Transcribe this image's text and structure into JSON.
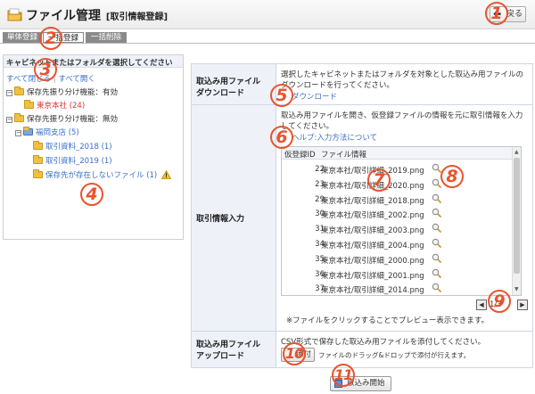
{
  "header": {
    "title": "ファイル管理",
    "subtitle": "[取引情報登録]",
    "back_label": "戻る"
  },
  "tabs": [
    "単体登録",
    "一括登録",
    "一括削除"
  ],
  "tree": {
    "heading": "キャビネットまたはフォルダを選択してください",
    "close_all": "すべて閉じる",
    "open_all": "すべて開く",
    "items": [
      {
        "label": "保存先振り分け機能：有効",
        "level": 0,
        "type": "toggle-folder"
      },
      {
        "label": "東京本社 (24)",
        "level": 1,
        "type": "folder",
        "selected": true
      },
      {
        "label": "保存先振り分け機能：無効",
        "level": 0,
        "type": "toggle-folder"
      },
      {
        "label": "福岡支店 (5)",
        "level": 1,
        "type": "cabinet"
      },
      {
        "label": "取引資料_2018 (1)",
        "level": 2,
        "type": "folder"
      },
      {
        "label": "取引資料_2019 (1)",
        "level": 2,
        "type": "folder"
      },
      {
        "label": "保存先が存在しないファイル (1)",
        "level": 2,
        "type": "folder-warning"
      }
    ]
  },
  "sections": {
    "download": {
      "label_line1": "取込み用ファイル",
      "label_line2": "ダウンロード",
      "desc_line1": "選択したキャビネットまたはフォルダを対象とした取込み用ファイルの",
      "desc_line2": "ダウンロードを行ってください。",
      "link": "ダウンロード"
    },
    "entry": {
      "label": "取引情報入力",
      "desc_line1": "取込み用ファイルを開き、仮登録ファイルの情報を元に取引情報を入力",
      "desc_line2": "してください。",
      "help_link": "ヘルプ:入力方法について",
      "col_id": "仮登録ID",
      "col_info": "ファイル情報",
      "files": [
        {
          "id": "22",
          "name": "東京本社/取引詳細_2019.png"
        },
        {
          "id": "23",
          "name": "東京本社/取引詳細_2020.png"
        },
        {
          "id": "29",
          "name": "東京本社/取引詳細_2018.png"
        },
        {
          "id": "30",
          "name": "東京本社/取引詳細_2002.png"
        },
        {
          "id": "31",
          "name": "東京本社/取引詳細_2003.png"
        },
        {
          "id": "34",
          "name": "東京本社/取引詳細_2004.png"
        },
        {
          "id": "35",
          "name": "東京本社/取引詳細_2000.png"
        },
        {
          "id": "36",
          "name": "東京本社/取引詳細_2001.png"
        },
        {
          "id": "37",
          "name": "東京本社/取引詳細_2014.png"
        }
      ],
      "pager": "1/3",
      "note": "※ファイルをクリックすることでプレビュー表示できます。"
    },
    "upload": {
      "label_line1": "取込み用ファイル",
      "label_line2": "アップロード",
      "desc": "CSV形式で保存した取込み用ファイルを添付してください。",
      "attach_label": "添付",
      "drop_hint": "ファイルのドラッグ&ドロップで添付が行えます。"
    }
  },
  "start_button": "取込み開始",
  "callouts": [
    "1",
    "2",
    "3",
    "4",
    "5",
    "6",
    "7",
    "8",
    "9",
    "10",
    "11"
  ],
  "colors": {
    "accent": "#e8542e",
    "link": "#3a6fc4",
    "selected": "#e03030",
    "tab_active": "#ffffff",
    "tab_inactive": "#8a8a8a"
  }
}
